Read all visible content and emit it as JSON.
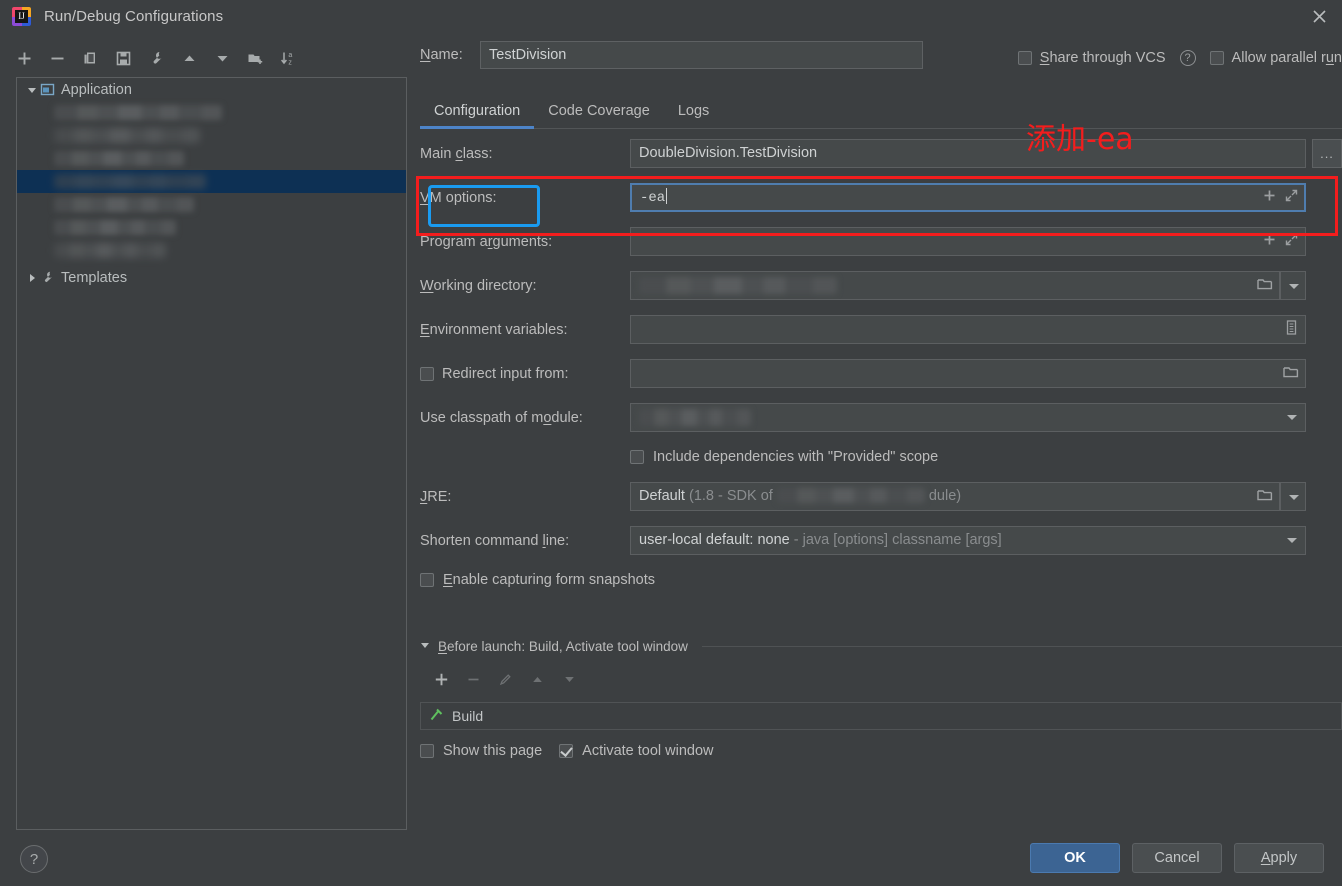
{
  "window": {
    "title": "Run/Debug Configurations",
    "logo_icon": "intellij-idea-logo",
    "close_icon": "close-icon"
  },
  "left_panel": {
    "toolbar": [
      {
        "name": "add-configuration-button",
        "icon": "plus-icon"
      },
      {
        "name": "remove-configuration-button",
        "icon": "minus-icon"
      },
      {
        "name": "copy-configuration-button",
        "icon": "copy-icon"
      },
      {
        "name": "save-configuration-button",
        "icon": "save-icon"
      },
      {
        "name": "edit-templates-button",
        "icon": "wrench-icon"
      },
      {
        "name": "move-up-button",
        "icon": "arrow-up-icon"
      },
      {
        "name": "move-down-button",
        "icon": "arrow-down-icon"
      },
      {
        "name": "new-folder-button",
        "icon": "folder-add-icon"
      },
      {
        "name": "sort-configurations-button",
        "icon": "sort-alphabetical-icon"
      }
    ],
    "tree": {
      "application_group": "Application",
      "application_icon": "application-window-icon",
      "templates_group": "Templates",
      "templates_icon": "wrench-icon",
      "redacted_children": 6,
      "selected_child_index": 3
    }
  },
  "help_button": {
    "label": "?",
    "icon": "question-mark-icon"
  },
  "header": {
    "name_label": "Name:",
    "name_value": "TestDivision",
    "share_vcs_label": "Share through VCS",
    "share_vcs_checked": false,
    "share_vcs_help_icon": "question-circle-icon",
    "allow_parallel_label": "Allow parallel run",
    "allow_parallel_checked": false
  },
  "tabs": [
    {
      "label": "Configuration",
      "active": true
    },
    {
      "label": "Code Coverage",
      "active": false
    },
    {
      "label": "Logs",
      "active": false
    }
  ],
  "configuration": {
    "main_class": {
      "label": "Main class:",
      "value": "DoubleDivision.TestDivision",
      "browse_label": "...",
      "browse_icon": "ellipsis-icon"
    },
    "vm_options": {
      "label": "VM options:",
      "value": "-ea",
      "focused": true,
      "add_icon": "plus-icon",
      "expand_icon": "expand-diagonal-icon"
    },
    "program_arguments": {
      "label": "Program arguments:",
      "value": "",
      "add_icon": "plus-icon",
      "expand_icon": "expand-diagonal-icon"
    },
    "working_directory": {
      "label": "Working directory:",
      "value": "",
      "redacted": true,
      "browse_icon": "folder-icon",
      "dropdown_icon": "chevron-down-icon"
    },
    "environment_variables": {
      "label": "Environment variables:",
      "value": "",
      "editor_icon": "list-edit-icon"
    },
    "redirect_input": {
      "label": "Redirect input from:",
      "checked": false,
      "value": "",
      "browse_icon": "folder-icon"
    },
    "classpath_module": {
      "label": "Use classpath of module:",
      "value": "",
      "redacted": true,
      "dropdown_icon": "chevron-down-icon"
    },
    "include_provided": {
      "label": "Include dependencies with \"Provided\" scope",
      "checked": false
    },
    "jre": {
      "label": "JRE:",
      "value_strong": "Default",
      "value_dim_prefix": "(1.8 - SDK of ",
      "value_dim_suffix": "dule)",
      "redacted": true,
      "browse_icon": "folder-icon",
      "dropdown_icon": "chevron-down-icon"
    },
    "shorten_command_line": {
      "label": "Shorten command line:",
      "value_strong": "user-local default: none",
      "value_dim": " - java [options] classname [args]",
      "dropdown_icon": "chevron-down-icon"
    },
    "form_snapshots": {
      "label": "Enable capturing form snapshots",
      "checked": false
    }
  },
  "before_launch": {
    "header": "Before launch: Build, Activate tool window",
    "collapse_icon": "triangle-down-icon",
    "toolbar": [
      {
        "name": "before-launch-add-button",
        "icon": "plus-icon",
        "enabled": true
      },
      {
        "name": "before-launch-remove-button",
        "icon": "minus-icon",
        "enabled": false
      },
      {
        "name": "before-launch-edit-button",
        "icon": "pencil-icon",
        "enabled": false
      },
      {
        "name": "before-launch-move-up-button",
        "icon": "arrow-up-icon",
        "enabled": false
      },
      {
        "name": "before-launch-move-down-button",
        "icon": "arrow-down-icon",
        "enabled": false
      }
    ],
    "items": [
      {
        "label": "Build",
        "icon": "build-hammer-icon"
      }
    ],
    "show_this_page": {
      "label": "Show this page",
      "checked": false
    },
    "activate_tool_window": {
      "label": "Activate tool window",
      "checked": true
    }
  },
  "footer": {
    "ok_label": "OK",
    "cancel_label": "Cancel",
    "apply_label": "Apply"
  },
  "annotations": {
    "note_text": "添加-ea",
    "note_color": "#f41d1d",
    "highlight_box_color": "#f41d1d",
    "label_box_color": "#1a9bf0"
  }
}
